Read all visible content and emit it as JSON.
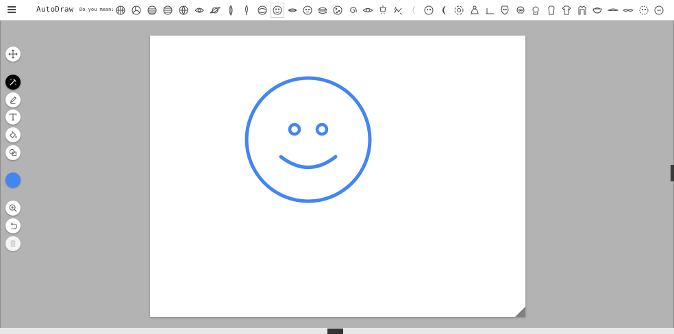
{
  "app": {
    "title": "AutoDraw"
  },
  "suggestions": {
    "label": "Do you mean:",
    "items": [
      {
        "icon": "basketball-icon"
      },
      {
        "icon": "volleyball-icon"
      },
      {
        "icon": "striped-ball-icon"
      },
      {
        "icon": "striped-circle-icon"
      },
      {
        "icon": "globe-icon"
      },
      {
        "icon": "eye-icon"
      },
      {
        "icon": "planet-icon"
      },
      {
        "icon": "diamond-leaf-icon"
      },
      {
        "icon": "feather-icon"
      },
      {
        "icon": "cake-icon"
      },
      {
        "icon": "smiley-face-icon",
        "active": true
      },
      {
        "icon": "lips-icon"
      },
      {
        "icon": "face-icon"
      },
      {
        "icon": "hamburger-icon"
      },
      {
        "icon": "cookie-icon"
      },
      {
        "icon": "spiral-icon"
      },
      {
        "icon": "watching-eye-icon"
      },
      {
        "icon": "stroller-icon"
      },
      {
        "icon": "crab-icon"
      },
      {
        "icon": "moon-light-icon"
      },
      {
        "icon": "cookie-face-icon"
      },
      {
        "icon": "crescent-moon-icon"
      },
      {
        "icon": "steering-wheel-icon"
      },
      {
        "icon": "flower-face-icon"
      },
      {
        "icon": "snail-icon"
      },
      {
        "icon": "boot-icon"
      },
      {
        "icon": "skull-icon"
      },
      {
        "icon": "puzzle-piece-icon"
      },
      {
        "icon": "clown-icon"
      },
      {
        "icon": "tshirt-icon"
      },
      {
        "icon": "shirt-icon"
      },
      {
        "icon": "jacket-icon"
      },
      {
        "icon": "bowl-icon"
      },
      {
        "icon": "mustache-icon"
      },
      {
        "icon": "eyes-icon"
      },
      {
        "icon": "cookie-round-icon"
      }
    ]
  },
  "toolbar": {
    "tools": [
      {
        "name": "move-tool",
        "icon": "move-arrows-icon"
      },
      {
        "name": "autodraw-tool",
        "icon": "autodraw-wand-icon",
        "selected": true
      },
      {
        "name": "draw-tool",
        "icon": "pencil-icon"
      },
      {
        "name": "type-tool",
        "icon": "text-t-icon"
      },
      {
        "name": "fill-tool",
        "icon": "paint-bucket-icon"
      },
      {
        "name": "shape-tool",
        "icon": "shapes-icon"
      },
      {
        "name": "zoom-tool",
        "icon": "zoom-in-icon"
      },
      {
        "name": "undo-tool",
        "icon": "undo-icon"
      },
      {
        "name": "delete-tool",
        "icon": "trash-icon",
        "disabled": true
      }
    ],
    "color": "#4285f4"
  },
  "canvas": {
    "stroke_color": "#4285f4",
    "drawing": "smiley-face"
  },
  "colors": {
    "accent": "#4285f4",
    "background": "#b3b3b3",
    "topbar": "#ffffff"
  }
}
